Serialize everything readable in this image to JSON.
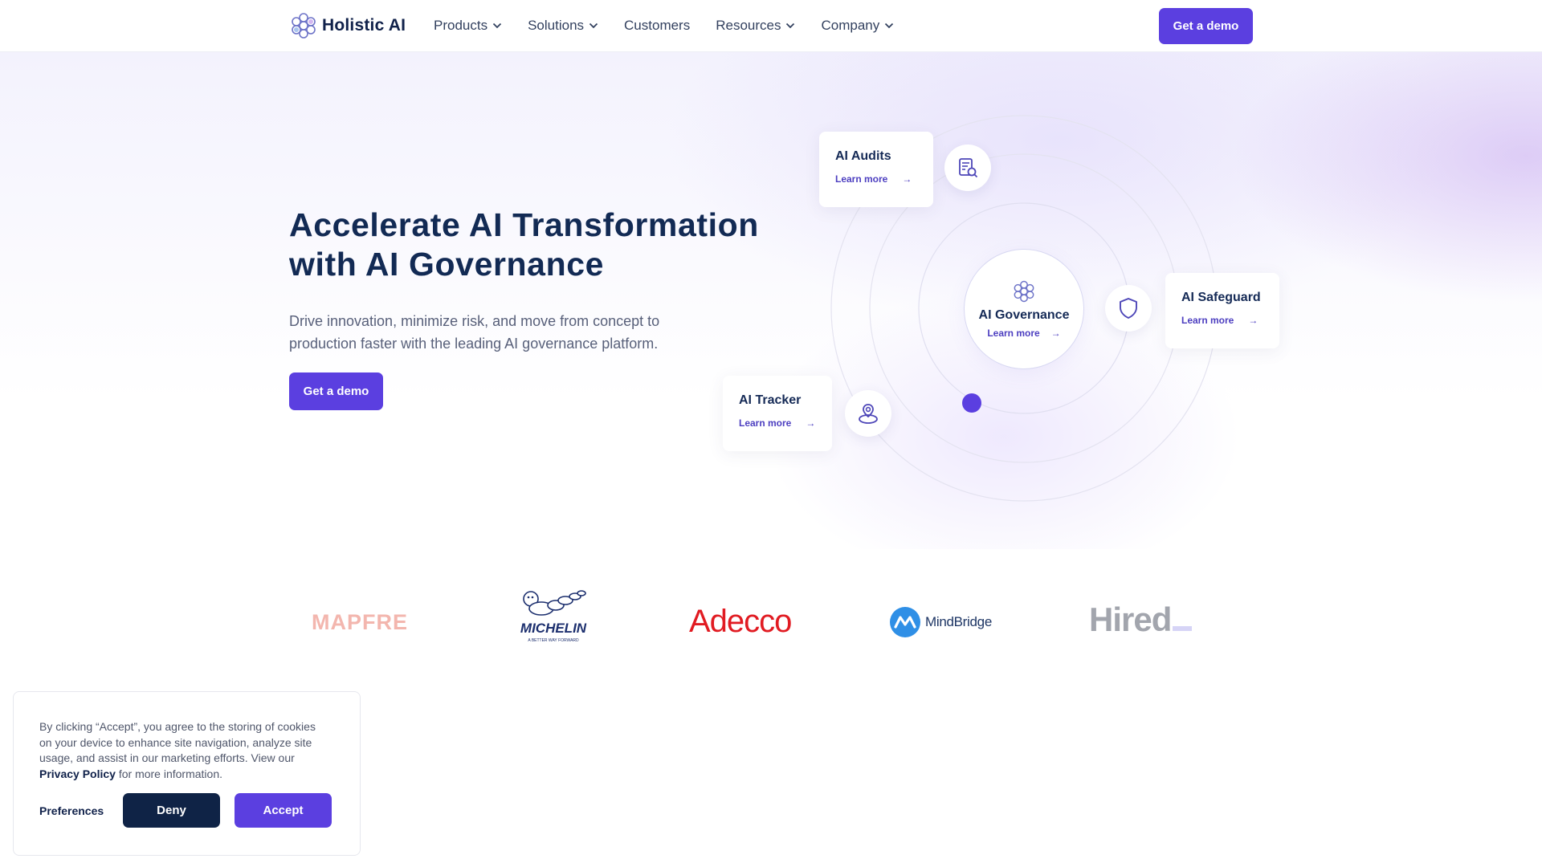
{
  "header": {
    "brand": "Holistic AI",
    "nav": [
      {
        "label": "Products",
        "has_dropdown": true
      },
      {
        "label": "Solutions",
        "has_dropdown": true
      },
      {
        "label": "Customers",
        "has_dropdown": false
      },
      {
        "label": "Resources",
        "has_dropdown": true
      },
      {
        "label": "Company",
        "has_dropdown": true
      }
    ],
    "cta_label": "Get a demo"
  },
  "hero": {
    "title_line1": "Accelerate AI Transformation",
    "title_line2": "with AI Governance",
    "subtitle_line1": "Drive innovation, minimize risk, and move from concept to",
    "subtitle_line2": "production faster with the leading AI governance platform.",
    "cta_label": "Get a demo"
  },
  "diagram": {
    "center": {
      "title": "AI Governance",
      "link": "Learn more",
      "arrow": "→"
    },
    "cards": [
      {
        "title": "AI Audits",
        "link": "Learn more",
        "arrow": "→",
        "icon": "document-search-icon"
      },
      {
        "title": "AI Safeguard",
        "link": "Learn more",
        "arrow": "→",
        "icon": "shield-icon"
      },
      {
        "title": "AI Tracker",
        "link": "Learn more",
        "arrow": "→",
        "icon": "location-pin-icon"
      }
    ]
  },
  "customer_logos": {
    "mapfre": "MAPFRE",
    "michelin": "MICHELIN",
    "michelin_tagline": "A BETTER WAY FORWARD",
    "adecco": "Adecco",
    "mindbridge": "MindBridge",
    "hired": "Hired"
  },
  "cookie_banner": {
    "text_line1": "By clicking “Accept”, you agree to the storing of cookies",
    "text_line2": "on your device to enhance site navigation, analyze site",
    "text_line3": "usage, and assist in our marketing efforts. View our",
    "privacy_link": "Privacy Policy",
    "text_tail": "for more information.",
    "preferences_label": "Preferences",
    "deny_label": "Deny",
    "accept_label": "Accept"
  },
  "colors": {
    "accent": "#5b3fe0",
    "navy": "#0f2346",
    "heading": "#122a54"
  }
}
